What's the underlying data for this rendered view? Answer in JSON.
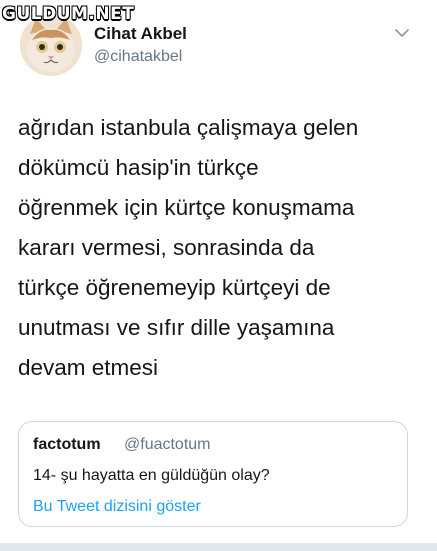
{
  "watermark": {
    "text": "GULDUM.NET"
  },
  "author": {
    "name": "Cihat Akbel",
    "handle": "@cihatakbel",
    "avatar_icon": "cat-avatar-icon"
  },
  "menu": {
    "icon": "chevron-down-icon"
  },
  "tweet": {
    "lines": [
      "ağrıdan istanbula çalişmaya gelen",
      "dökümcü hasip'in türkçe",
      "öğrenmek için kürtçe konuşmama",
      "kararı vermesi, sonrasinda da",
      "türkçe öğrenemeyip kürtçeyi de",
      "unutması ve sıfır dille yaşamına",
      "devam etmesi"
    ]
  },
  "quote": {
    "name": "factotum",
    "handle": "@fuactotum",
    "text": "14- şu hayatta en güldüğün olay?",
    "link_label": "Bu Tweet dizisini göster"
  },
  "colors": {
    "text": "#14171a",
    "secondary": "#657786",
    "link": "#1da1f2",
    "border": "#ccd6dd"
  }
}
